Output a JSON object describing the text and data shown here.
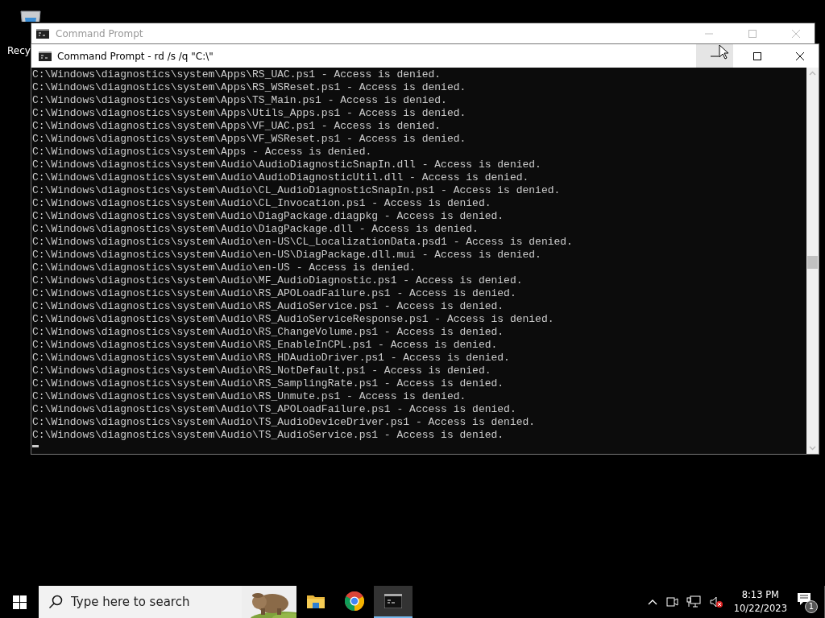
{
  "desktop": {
    "icons": [
      {
        "label": "Recy"
      }
    ]
  },
  "background_window": {
    "title": "Command Prompt"
  },
  "window": {
    "title": "Command Prompt - rd  /s /q \"C:\\\"",
    "minimize_hovered": true,
    "lines": [
      "C:\\Windows\\diagnostics\\system\\Apps\\RS_UAC.ps1 - Access is denied.",
      "C:\\Windows\\diagnostics\\system\\Apps\\RS_WSReset.ps1 - Access is denied.",
      "C:\\Windows\\diagnostics\\system\\Apps\\TS_Main.ps1 - Access is denied.",
      "C:\\Windows\\diagnostics\\system\\Apps\\Utils_Apps.ps1 - Access is denied.",
      "C:\\Windows\\diagnostics\\system\\Apps\\VF_UAC.ps1 - Access is denied.",
      "C:\\Windows\\diagnostics\\system\\Apps\\VF_WSReset.ps1 - Access is denied.",
      "C:\\Windows\\diagnostics\\system\\Apps - Access is denied.",
      "C:\\Windows\\diagnostics\\system\\Audio\\AudioDiagnosticSnapIn.dll - Access is denied.",
      "C:\\Windows\\diagnostics\\system\\Audio\\AudioDiagnosticUtil.dll - Access is denied.",
      "C:\\Windows\\diagnostics\\system\\Audio\\CL_AudioDiagnosticSnapIn.ps1 - Access is denied.",
      "C:\\Windows\\diagnostics\\system\\Audio\\CL_Invocation.ps1 - Access is denied.",
      "C:\\Windows\\diagnostics\\system\\Audio\\DiagPackage.diagpkg - Access is denied.",
      "C:\\Windows\\diagnostics\\system\\Audio\\DiagPackage.dll - Access is denied.",
      "C:\\Windows\\diagnostics\\system\\Audio\\en-US\\CL_LocalizationData.psd1 - Access is denied.",
      "C:\\Windows\\diagnostics\\system\\Audio\\en-US\\DiagPackage.dll.mui - Access is denied.",
      "C:\\Windows\\diagnostics\\system\\Audio\\en-US - Access is denied.",
      "C:\\Windows\\diagnostics\\system\\Audio\\MF_AudioDiagnostic.ps1 - Access is denied.",
      "C:\\Windows\\diagnostics\\system\\Audio\\RS_APOLoadFailure.ps1 - Access is denied.",
      "C:\\Windows\\diagnostics\\system\\Audio\\RS_AudioService.ps1 - Access is denied.",
      "C:\\Windows\\diagnostics\\system\\Audio\\RS_AudioServiceResponse.ps1 - Access is denied.",
      "C:\\Windows\\diagnostics\\system\\Audio\\RS_ChangeVolume.ps1 - Access is denied.",
      "C:\\Windows\\diagnostics\\system\\Audio\\RS_EnableInCPL.ps1 - Access is denied.",
      "C:\\Windows\\diagnostics\\system\\Audio\\RS_HDAudioDriver.ps1 - Access is denied.",
      "C:\\Windows\\diagnostics\\system\\Audio\\RS_NotDefault.ps1 - Access is denied.",
      "C:\\Windows\\diagnostics\\system\\Audio\\RS_SamplingRate.ps1 - Access is denied.",
      "C:\\Windows\\diagnostics\\system\\Audio\\RS_Unmute.ps1 - Access is denied.",
      "C:\\Windows\\diagnostics\\system\\Audio\\TS_APOLoadFailure.ps1 - Access is denied.",
      "C:\\Windows\\diagnostics\\system\\Audio\\TS_AudioDeviceDriver.ps1 - Access is denied.",
      "C:\\Windows\\diagnostics\\system\\Audio\\TS_AudioService.ps1 - Access is denied."
    ]
  },
  "taskbar": {
    "search": {
      "placeholder": "Type here to search"
    },
    "apps": [
      {
        "kind": "folder",
        "selected": false
      },
      {
        "kind": "browser",
        "selected": false
      },
      {
        "kind": "terminal",
        "selected": true
      }
    ],
    "tray": {
      "time": "8:13 PM",
      "date": "10/22/2023",
      "sound_muted": true,
      "notifications": "1"
    }
  }
}
